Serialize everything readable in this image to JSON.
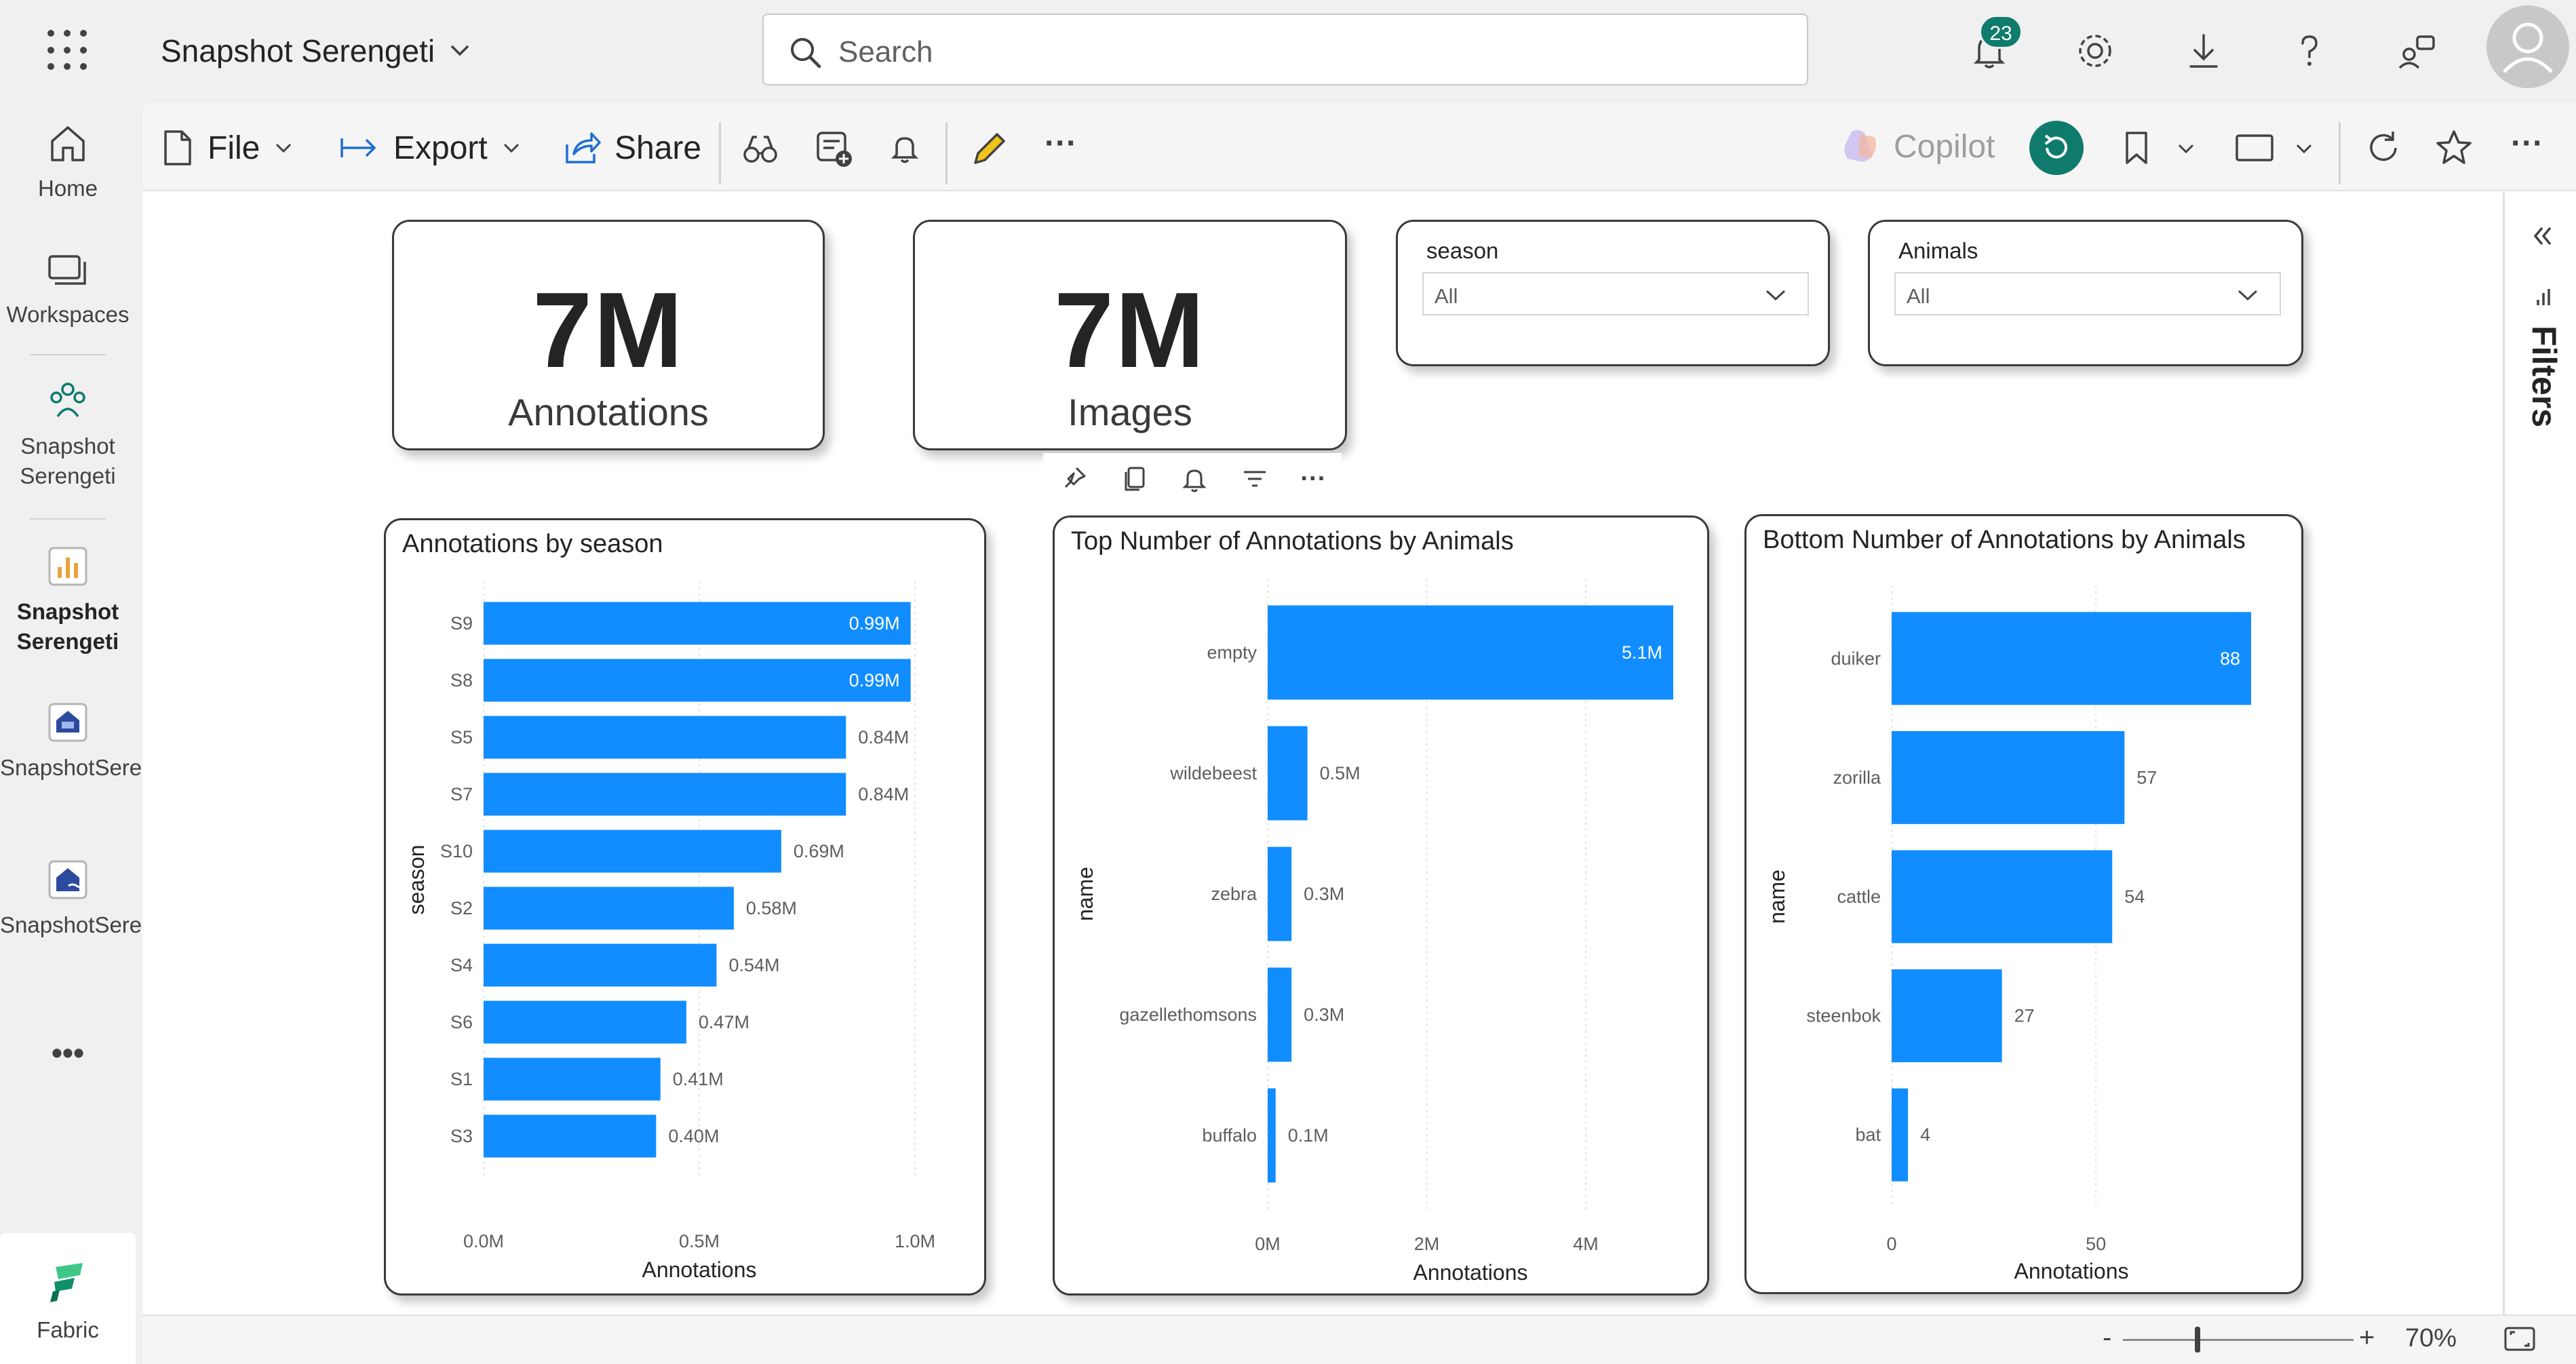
{
  "app": {
    "title": "Snapshot Serengeti",
    "search_placeholder": "Search",
    "notification_count": "23"
  },
  "leftnav": {
    "items": [
      {
        "label": "Home"
      },
      {
        "label": "Workspaces"
      },
      {
        "label": "Snapshot Serengeti"
      },
      {
        "label": "Snapshot Serengeti"
      },
      {
        "label": "SnapshotSerengeti_LH"
      },
      {
        "label": "SnapshotSerengeti_LH"
      }
    ],
    "more": "•••",
    "fabric_label": "Fabric"
  },
  "toolbar": {
    "file": "File",
    "export": "Export",
    "share": "Share",
    "copilot": "Copilot",
    "more": "···"
  },
  "filters_pane": {
    "label": "Filters"
  },
  "kpis": [
    {
      "value": "7M",
      "label": "Annotations"
    },
    {
      "value": "7M",
      "label": "Images"
    }
  ],
  "slicers": [
    {
      "title": "season",
      "value": "All"
    },
    {
      "title": "Animals",
      "value": "All"
    }
  ],
  "status": {
    "zoom": "70%",
    "minus": "-",
    "plus": "+"
  },
  "colors": {
    "bar": "#118dff",
    "accent": "#0f7b6c"
  },
  "chart_data": [
    {
      "type": "bar",
      "orientation": "horizontal",
      "title": "Annotations by season",
      "ylabel": "season",
      "xlabel": "Annotations",
      "xlim": [
        0,
        1.0
      ],
      "x_unit": "M",
      "x_ticks": [
        "0.0M",
        "0.5M",
        "1.0M"
      ],
      "categories": [
        "S9",
        "S8",
        "S5",
        "S7",
        "S10",
        "S2",
        "S4",
        "S6",
        "S1",
        "S3"
      ],
      "values": [
        0.99,
        0.99,
        0.84,
        0.84,
        0.69,
        0.58,
        0.54,
        0.47,
        0.41,
        0.4
      ],
      "data_labels": [
        "0.99M",
        "0.99M",
        "0.84M",
        "0.84M",
        "0.69M",
        "0.58M",
        "0.54M",
        "0.47M",
        "0.41M",
        "0.40M"
      ],
      "grid": true
    },
    {
      "type": "bar",
      "orientation": "horizontal",
      "title": "Top Number of Annotations by Animals",
      "ylabel": "name",
      "xlabel": "Annotations",
      "xlim": [
        0,
        5.1
      ],
      "x_unit": "M",
      "x_ticks": [
        "0M",
        "2M",
        "4M"
      ],
      "categories": [
        "empty",
        "wildebeest",
        "zebra",
        "gazellethomsons",
        "buffalo"
      ],
      "values": [
        5.1,
        0.5,
        0.3,
        0.3,
        0.1
      ],
      "data_labels": [
        "5.1M",
        "0.5M",
        "0.3M",
        "0.3M",
        "0.1M"
      ],
      "grid": true
    },
    {
      "type": "bar",
      "orientation": "horizontal",
      "title": "Bottom Number of Annotations by Animals",
      "ylabel": "name",
      "xlabel": "Annotations",
      "xlim": [
        0,
        88
      ],
      "x_ticks": [
        "0",
        "50"
      ],
      "categories": [
        "duiker",
        "zorilla",
        "cattle",
        "steenbok",
        "bat"
      ],
      "values": [
        88,
        57,
        54,
        27,
        4
      ],
      "data_labels": [
        "88",
        "57",
        "54",
        "27",
        "4"
      ],
      "grid": true
    }
  ]
}
